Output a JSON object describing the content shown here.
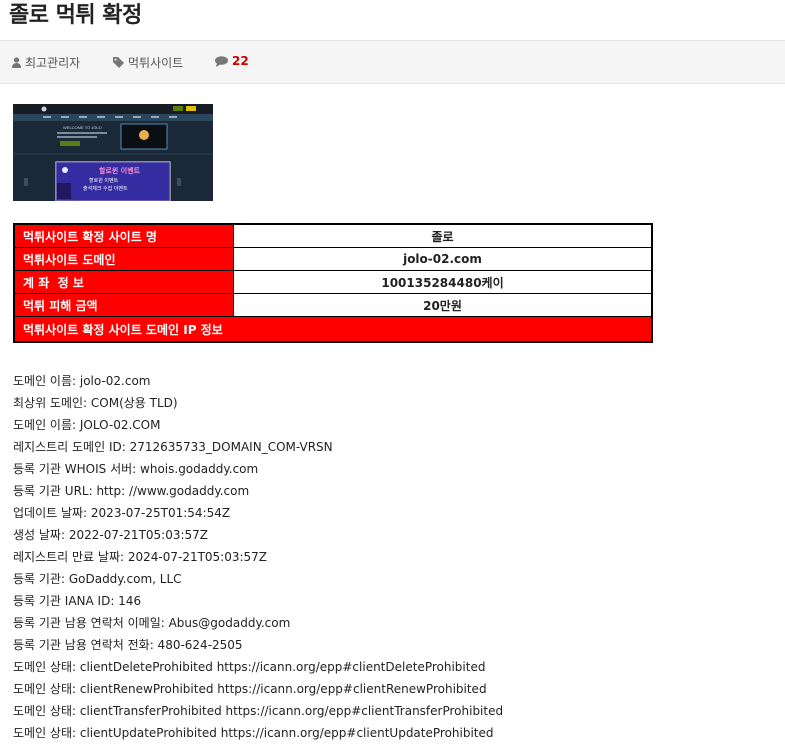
{
  "page": {
    "title": "졸로 먹튀 확정"
  },
  "meta": {
    "author": "최고관리자",
    "category": "먹튀사이트",
    "comments": "22"
  },
  "thumbnail": {
    "welcome": "WELCOME TO JOLO",
    "banner_title": "할로윈 이벤트",
    "banner_line1": "할로윈 이벤트",
    "banner_line2": "출석체크 수집 이벤트"
  },
  "table": {
    "rows": [
      {
        "label": "먹튀사이트 확정 사이트 명",
        "value": "졸로"
      },
      {
        "label": "먹튀사이트 도메인",
        "value": "jolo-02.com"
      },
      {
        "label": "계 좌  정 보",
        "value": "100135284480케이"
      },
      {
        "label": "먹튀 피해 금액",
        "value": "20만원"
      }
    ],
    "footer": "먹튀사이트 확정 사이트 도메인 IP 정보"
  },
  "whois": [
    "도메인 이름: jolo-02.com",
    "최상위 도메인: COM(상용 TLD)",
    "도메인 이름: JOLO-02.COM",
    "레지스트리 도메인 ID: 2712635733_DOMAIN_COM-VRSN",
    "등록 기관 WHOIS 서버: whois.godaddy.com",
    "등록 기관 URL: http: //www.godaddy.com",
    "업데이트 날짜: 2023-07-25T01:54:54Z",
    "생성 날짜: 2022-07-21T05:03:57Z",
    "레지스트리 만료 날짜: 2024-07-21T05:03:57Z",
    "등록 기관: GoDaddy.com, LLC",
    "등록 기관 IANA ID: 146",
    "등록 기관 남용 연락처 이메일: Abus@godaddy.com",
    "등록 기관 남용 연락처 전화: 480-624-2505",
    "도메인 상태: clientDeleteProhibited https://icann.org/epp#clientDeleteProhibited",
    "도메인 상태: clientRenewProhibited https://icann.org/epp#clientRenewProhibited",
    "도메인 상태: clientTransferProhibited https://icann.org/epp#clientTransferProhibited",
    "도메인 상태: clientUpdateProhibited https://icann.org/epp#clientUpdateProhibited"
  ]
}
